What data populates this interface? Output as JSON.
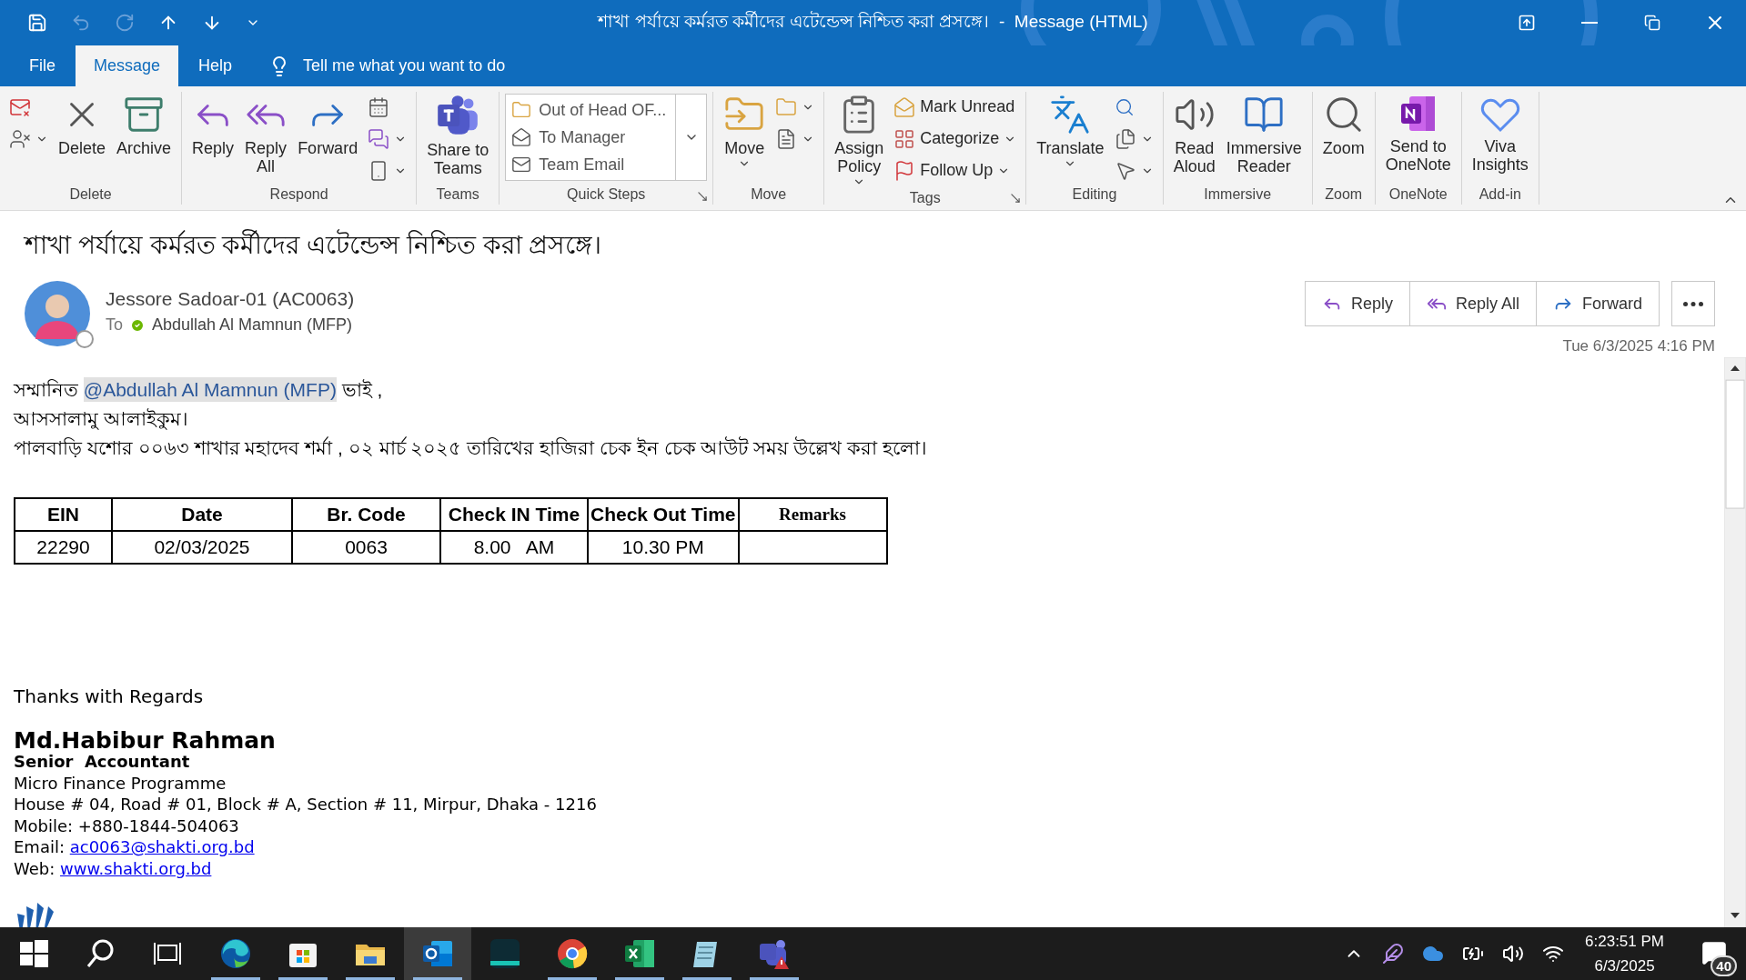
{
  "window": {
    "title": "শাখা পর্যায়ে কর্মরত কর্মীদের এটেন্ডেন্স নিশ্চিত করা প্রসঙ্গে।  -  Message (HTML)"
  },
  "tabs": [
    {
      "label": "File",
      "selected": false
    },
    {
      "label": "Message",
      "selected": true
    },
    {
      "label": "Help",
      "selected": false
    }
  ],
  "tell_me": {
    "placeholder": "Tell me what you want to do"
  },
  "ribbon": {
    "groups": [
      {
        "label": "Delete",
        "items": [
          {
            "kind": "stack",
            "buttons": [
              {
                "caret": false
              },
              {
                "caret": true
              }
            ]
          },
          {
            "kind": "large",
            "label": "Delete"
          },
          {
            "kind": "large",
            "label": "Archive"
          }
        ]
      },
      {
        "label": "Respond",
        "items": [
          {
            "kind": "large",
            "label": "Reply"
          },
          {
            "kind": "large",
            "label": "Reply\nAll"
          },
          {
            "kind": "large",
            "label": "Forward"
          },
          {
            "kind": "stack",
            "buttons": [
              {
                "caret": false
              },
              {
                "caret": true
              },
              {
                "caret": true
              }
            ]
          }
        ]
      },
      {
        "label": "Teams",
        "items": [
          {
            "kind": "large",
            "label": "Share to\nTeams"
          }
        ]
      },
      {
        "label": "Quick Steps",
        "launcher": true,
        "items": [
          {
            "kind": "gallery",
            "entries": [
              "Out of Head OF...",
              "To Manager",
              "Team Email"
            ]
          }
        ]
      },
      {
        "label": "Move",
        "items": [
          {
            "kind": "large",
            "label": "Move",
            "caret": true
          },
          {
            "kind": "stack",
            "buttons": [
              {
                "caret": true
              },
              {
                "caret": true
              }
            ]
          }
        ]
      },
      {
        "label": "Tags",
        "launcher": true,
        "items": [
          {
            "kind": "large",
            "label": "Assign\nPolicy",
            "caret": true
          },
          {
            "kind": "stack",
            "buttons": [
              {
                "label": "Mark Unread",
                "caret": false
              },
              {
                "label": "Categorize",
                "caret": true
              },
              {
                "label": "Follow Up",
                "caret": true
              }
            ]
          }
        ]
      },
      {
        "label": "Editing",
        "items": [
          {
            "kind": "large",
            "label": "Translate",
            "caret": true
          },
          {
            "kind": "stack",
            "buttons": [
              {
                "caret": false
              },
              {
                "caret": true
              },
              {
                "caret": true
              }
            ]
          }
        ]
      },
      {
        "label": "Immersive",
        "items": [
          {
            "kind": "large",
            "label": "Read\nAloud"
          },
          {
            "kind": "large",
            "label": "Immersive\nReader"
          }
        ]
      },
      {
        "label": "Zoom",
        "items": [
          {
            "kind": "large",
            "label": "Zoom"
          }
        ]
      },
      {
        "label": "OneNote",
        "items": [
          {
            "kind": "large",
            "label": "Send to\nOneNote"
          }
        ]
      },
      {
        "label": "Add-in",
        "items": [
          {
            "kind": "large",
            "label": "Viva\nInsights"
          }
        ]
      }
    ]
  },
  "message": {
    "subject": "শাখা পর্যায়ে কর্মরত কর্মীদের এটেন্ডেন্স নিশ্চিত করা প্রসঙ্গে।",
    "sender": {
      "name": "Jessore Sadoar-01 (AC0063)",
      "available": false
    },
    "to_label": "To",
    "recipient": {
      "name": "Abdullah Al Mamnun (MFP)",
      "available": true
    },
    "actions": [
      {
        "label": "Reply"
      },
      {
        "label": "Reply All"
      },
      {
        "label": "Forward"
      }
    ],
    "date": "Tue 6/3/2025 4:16 PM"
  },
  "body": {
    "greeting": {
      "before": "সম্মানিত ",
      "mention": "@Abdullah Al Mamnun (MFP)",
      "after": " ভাই ,"
    },
    "salutation": "আসসালামু আলাইকুম।",
    "intro": "পালবাড়ি যশোর ০০৬৩ শাখার মহাদেব শর্মা , ০২ মার্চ ২০২৫ তারিখের হাজিরা চেক ইন চেক আউট সময় উল্লেখ করা হলো।",
    "table": {
      "columns": [
        "EIN",
        "Date",
        "Br. Code",
        "Check IN Time",
        "Check Out Time",
        "Remarks"
      ],
      "rows": [
        [
          "22290",
          "02/03/2025",
          "0063",
          "8.00   AM",
          "10.30 PM",
          ""
        ]
      ]
    },
    "closing": "Thanks with Regards",
    "signature": {
      "name": "Md.Habibur Rahman",
      "title": "Senior  Accountant",
      "org": "Micro Finance Programme",
      "address": "House # 04, Road # 01, Block # A, Section # 11, Mirpur, Dhaka - 1216",
      "mobile": "Mobile: +880-1844-504063",
      "email": {
        "label": "Email: ",
        "link": "ac0063@shakti.org.bd"
      },
      "web": {
        "label": "Web: ",
        "link": "www.shakti.org.bd"
      }
    }
  },
  "taskbar": {
    "apps": [
      {
        "selected": false,
        "running": false
      },
      {
        "selected": false,
        "running": false
      },
      {
        "selected": false,
        "running": false
      },
      {
        "selected": false,
        "running": true
      },
      {
        "selected": false,
        "running": true
      },
      {
        "selected": false,
        "running": true
      },
      {
        "selected": true,
        "running": true
      },
      {
        "selected": false,
        "running": false
      },
      {
        "selected": false,
        "running": true
      },
      {
        "selected": false,
        "running": true
      },
      {
        "selected": false,
        "running": true
      },
      {
        "selected": false,
        "running": true
      }
    ],
    "time": "6:23:51 PM",
    "date": "6/3/2025",
    "notifications": "40"
  }
}
